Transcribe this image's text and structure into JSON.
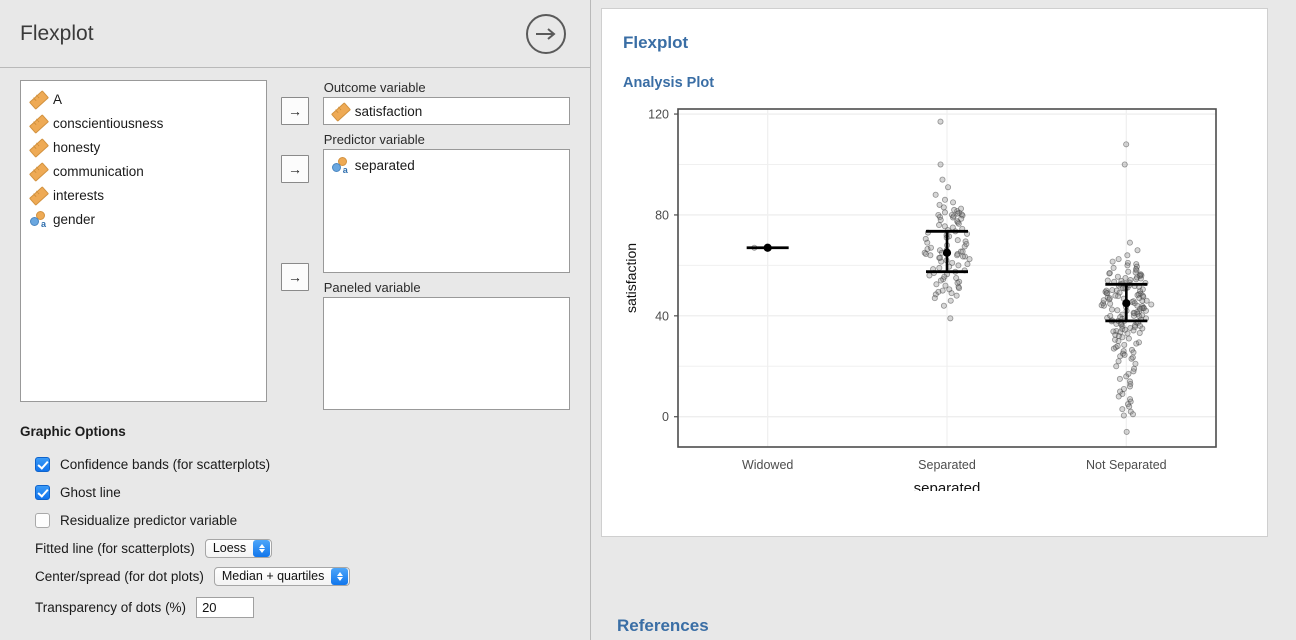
{
  "header": {
    "title": "Flexplot",
    "forward_icon": "arrow-right-circle-icon"
  },
  "variable_list": {
    "items": [
      {
        "label": "A",
        "icon": "continuous-ruler-icon"
      },
      {
        "label": "conscientiousness",
        "icon": "continuous-ruler-icon"
      },
      {
        "label": "honesty",
        "icon": "continuous-ruler-icon"
      },
      {
        "label": "communication",
        "icon": "continuous-ruler-icon"
      },
      {
        "label": "interests",
        "icon": "continuous-ruler-icon"
      },
      {
        "label": "gender",
        "icon": "nominal-icon"
      }
    ]
  },
  "assign_buttons": {
    "outcome": "→",
    "predictor": "→",
    "paneled": "→"
  },
  "fields": {
    "outcome": {
      "label": "Outcome variable",
      "values": [
        {
          "label": "satisfaction",
          "icon": "continuous-ruler-icon"
        }
      ]
    },
    "predictor": {
      "label": "Predictor variable",
      "values": [
        {
          "label": "separated",
          "icon": "nominal-icon"
        }
      ]
    },
    "paneled": {
      "label": "Paneled variable",
      "values": []
    }
  },
  "graphic_options": {
    "title": "Graphic Options",
    "checkboxes": [
      {
        "label": "Confidence bands (for scatterplots)",
        "checked": true
      },
      {
        "label": "Ghost line",
        "checked": true
      },
      {
        "label": "Residualize predictor variable",
        "checked": false
      }
    ],
    "selects": [
      {
        "label": "Fitted line (for scatterplots)",
        "value": "Loess"
      },
      {
        "label": "Center/spread (for dot plots)",
        "value": "Median + quartiles"
      }
    ],
    "number_input": {
      "label": "Transparency of dots (%)",
      "value": "20"
    }
  },
  "results": {
    "title": "Flexplot",
    "section_title": "Analysis Plot",
    "references_title": "References"
  },
  "colors": {
    "accent_heading": "#3a6ea5",
    "checkbox_on": "#1176ec",
    "panel_bg": "#e8e8e8",
    "card_bg": "#ffffff",
    "icon_orange": "#eeaa55",
    "icon_blue": "#6aa7e0",
    "point_gray": "#808080"
  },
  "chart_data": {
    "type": "scatter",
    "title": "",
    "xlabel": "separated",
    "ylabel": "satisfaction",
    "categories": [
      "Widowed",
      "Separated",
      "Not Separated"
    ],
    "ylim": [
      -12,
      122
    ],
    "yticks": [
      0,
      40,
      80,
      120
    ],
    "yticklabels": [
      "0",
      "40",
      "80",
      "120"
    ],
    "minor_gridlines": [
      20,
      60,
      100
    ],
    "grid": true,
    "legend": "none",
    "center_spread": "Median + quartiles",
    "summary": [
      {
        "group": "Widowed",
        "median": 67.0,
        "q1": 67.0,
        "q3": 67.0,
        "n": 1
      },
      {
        "group": "Separated",
        "median": 65.0,
        "q1": 57.5,
        "q3": 73.5,
        "n": 95
      },
      {
        "group": "Not Separated",
        "median": 45.0,
        "q1": 38.0,
        "q3": 52.5,
        "n": 175
      }
    ],
    "points": {
      "Widowed": [
        67
      ],
      "Separated": [
        117,
        100,
        94,
        91,
        88,
        86,
        85,
        84,
        83,
        82.5,
        82,
        81.5,
        81,
        80.8,
        80.5,
        80.2,
        80,
        80,
        79.8,
        79.5,
        79.2,
        79,
        78.5,
        78,
        77.5,
        77,
        76.5,
        76,
        75.5,
        75,
        74.5,
        74,
        73.5,
        73,
        72.5,
        72,
        71.5,
        71,
        70.5,
        70,
        69.5,
        69,
        68.5,
        68,
        67.5,
        67,
        66.5,
        66,
        66,
        65.5,
        65.5,
        65,
        65,
        64.5,
        64.5,
        64,
        64,
        63.5,
        63.5,
        63,
        63,
        62.5,
        62,
        61.5,
        61,
        60.5,
        60,
        59.5,
        59,
        58.5,
        58,
        57.5,
        57,
        56.5,
        56,
        55.5,
        55,
        54.5,
        54,
        53.5,
        53,
        52.5,
        52,
        51.5,
        51,
        50.5,
        50,
        49.5,
        49,
        48.5,
        48,
        47,
        46,
        44,
        39
      ],
      "Not Separated": [
        108,
        100,
        69,
        66,
        64,
        62.5,
        61.5,
        61,
        60.5,
        60,
        59.5,
        59,
        58.5,
        58,
        57.5,
        57.2,
        57,
        56.8,
        56.5,
        56.2,
        56,
        55.8,
        55.5,
        55.2,
        55,
        54.8,
        54.5,
        54.2,
        54,
        53.8,
        53.5,
        53.2,
        53,
        52.8,
        52.5,
        52.2,
        52,
        51.8,
        51.5,
        51.2,
        51,
        50.8,
        50.5,
        50.2,
        50,
        49.8,
        49.5,
        49.2,
        49,
        48.8,
        48.5,
        48.2,
        48,
        47.8,
        47.5,
        47.2,
        47,
        46.8,
        46.5,
        46.2,
        46,
        45.8,
        45.5,
        45.2,
        45,
        45,
        44.8,
        44.5,
        44.2,
        44,
        43.8,
        43.5,
        43.2,
        43,
        42.8,
        42.5,
        42.2,
        42,
        41.8,
        41.5,
        41.2,
        41,
        40.8,
        40.5,
        40.2,
        40,
        39.8,
        39.5,
        39.2,
        39,
        38.8,
        38.5,
        38.2,
        38,
        37.8,
        37.5,
        37.2,
        37,
        36.8,
        36.5,
        36.2,
        36,
        35.8,
        35.5,
        35.2,
        35,
        34.8,
        34.5,
        34.2,
        34,
        33.8,
        33.5,
        33.2,
        33,
        32.5,
        32,
        31.5,
        31,
        30.5,
        30,
        29.5,
        29,
        28.5,
        28,
        27.5,
        27,
        26.5,
        26,
        25.5,
        25,
        24.5,
        24,
        23.5,
        23,
        22,
        21,
        20,
        19,
        18,
        17,
        16,
        15,
        14,
        13,
        12,
        11,
        10,
        9,
        8,
        7,
        6,
        5,
        4,
        3,
        2,
        1,
        0.5,
        -6,
        52.5,
        50,
        48,
        46,
        44,
        42,
        40,
        38,
        47,
        45,
        43,
        51,
        49
      ]
    }
  }
}
